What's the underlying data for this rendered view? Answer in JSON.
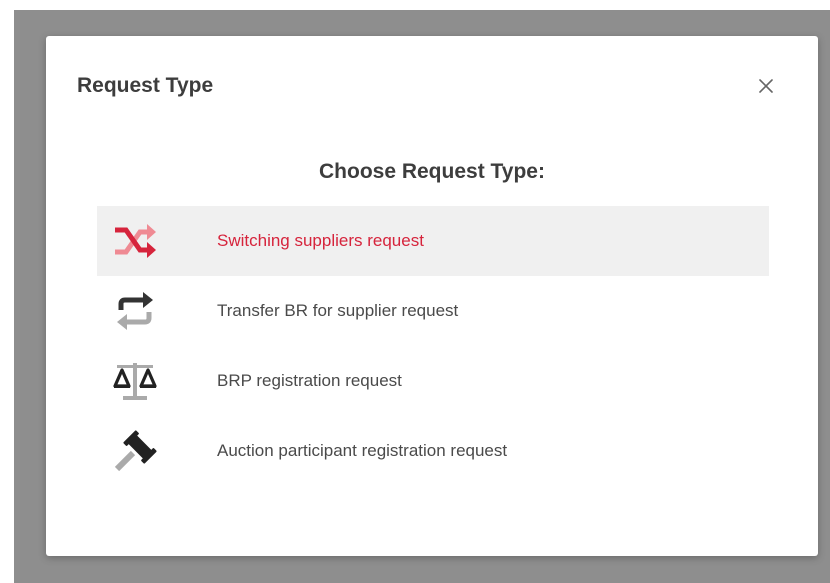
{
  "modal": {
    "title": "Request Type",
    "close_icon": "close-icon",
    "subtitle": "Choose Request Type:"
  },
  "options": [
    {
      "label": "Switching suppliers request",
      "icon": "shuffle-icon",
      "selected": true
    },
    {
      "label": "Transfer BR for supplier request",
      "icon": "transfer-icon",
      "selected": false
    },
    {
      "label": "BRP registration request",
      "icon": "scale-icon",
      "selected": false
    },
    {
      "label": "Auction participant registration request",
      "icon": "gavel-icon",
      "selected": false
    }
  ],
  "colors": {
    "accent": "#d6243c",
    "accent_light": "#ef8a93",
    "icon_dark": "#333333",
    "icon_light": "#aaaaaa",
    "selected_bg": "#f0f0f0",
    "overlay": "#8e8e8e"
  }
}
